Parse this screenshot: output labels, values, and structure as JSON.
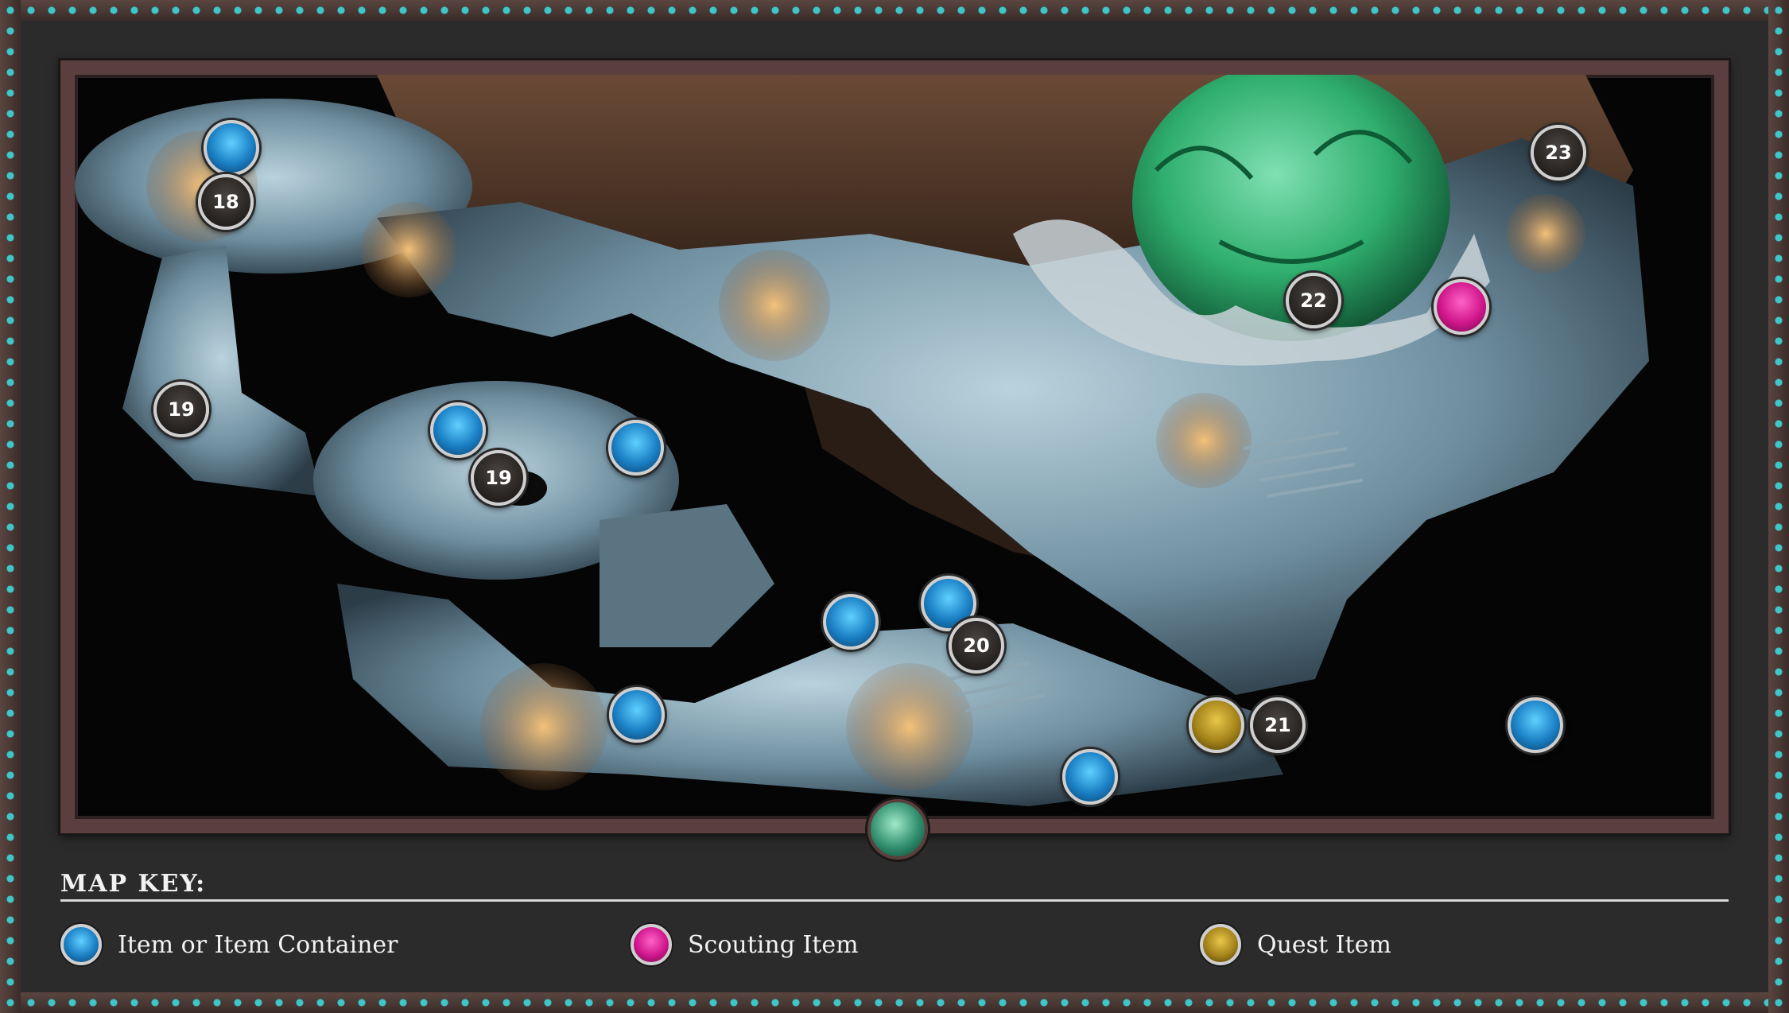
{
  "map": {
    "markers": {
      "m18": "18",
      "m19a": "19",
      "m19b": "19",
      "m20": "20",
      "m21": "21",
      "m22": "22",
      "m23": "23"
    }
  },
  "key": {
    "title": "MAP KEY:",
    "items": [
      {
        "label": "Item or Item Container",
        "color": "#1a7fc4"
      },
      {
        "label": "Scouting Item",
        "color": "#d0168c"
      },
      {
        "label": "Quest Item",
        "color": "#a4831a"
      }
    ]
  }
}
